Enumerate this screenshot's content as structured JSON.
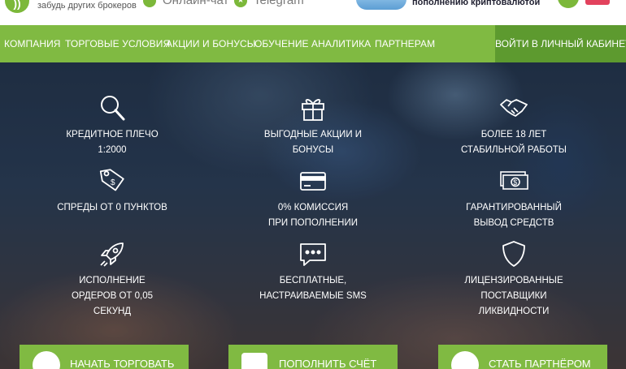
{
  "header": {
    "logo_glyph": "))",
    "tagline": "забудь других брокеров",
    "contact_online": "Онлайн-чат",
    "contact_telegram": "Telegram",
    "promo_text": "пополнению криптовалютой"
  },
  "nav": {
    "items": [
      "КОМПАНИЯ",
      "ТОРГОВЫЕ УСЛОВИЯ",
      "АКЦИИ И БОНУСЫ",
      "ОБУЧЕНИЕ",
      "АНАЛИТИКА",
      "ПАРТНЕРАМ"
    ],
    "login": "ВОЙТИ В ЛИЧНЫЙ КАБИНЕТ"
  },
  "features": [
    {
      "icon": "magnifier-icon",
      "lines": [
        "КРЕДИТНОЕ ПЛЕЧО",
        "1:2000"
      ]
    },
    {
      "icon": "gift-icon",
      "lines": [
        "ВЫГОДНЫЕ АКЦИИ И",
        "БОНУСЫ"
      ]
    },
    {
      "icon": "handshake-icon",
      "lines": [
        "БОЛЕЕ 18 ЛЕТ",
        "СТАБИЛЬНОЙ РАБОТЫ"
      ]
    },
    {
      "icon": "price-tag-icon",
      "lines": [
        "СПРЕДЫ ОТ 0 ПУНКТОВ"
      ]
    },
    {
      "icon": "credit-card-icon",
      "lines": [
        "0% КОМИССИЯ",
        "ПРИ ПОПОЛНЕНИИ"
      ]
    },
    {
      "icon": "banknotes-icon",
      "lines": [
        "ГАРАНТИРОВАННЫЙ",
        "ВЫВОД СРЕДСТВ"
      ]
    },
    {
      "icon": "rocket-icon",
      "lines": [
        "ИСПОЛНЕНИЕ",
        "ОРДЕРОВ ОТ 0,05",
        "СЕКУНД"
      ]
    },
    {
      "icon": "chat-bubble-icon",
      "lines": [
        "БЕСПЛАТНЫЕ,",
        "НАСТРАИВАЕМЫЕ SMS"
      ]
    },
    {
      "icon": "shield-icon",
      "lines": [
        "ЛИЦЕНЗИРОВАННЫЕ",
        "ПОСТАВЩИКИ",
        "ЛИКВИДНОСТИ"
      ]
    }
  ],
  "cta": {
    "start_trading": "НАЧАТЬ ТОРГОВАТЬ",
    "deposit": "ПОПОЛНИТЬ СЧЁТ",
    "partner": "СТАТЬ ПАРТНЁРОМ"
  },
  "colors": {
    "brand_green": "#80ba42",
    "login_green": "#5d9a2f",
    "accent_red": "#e2425d"
  }
}
